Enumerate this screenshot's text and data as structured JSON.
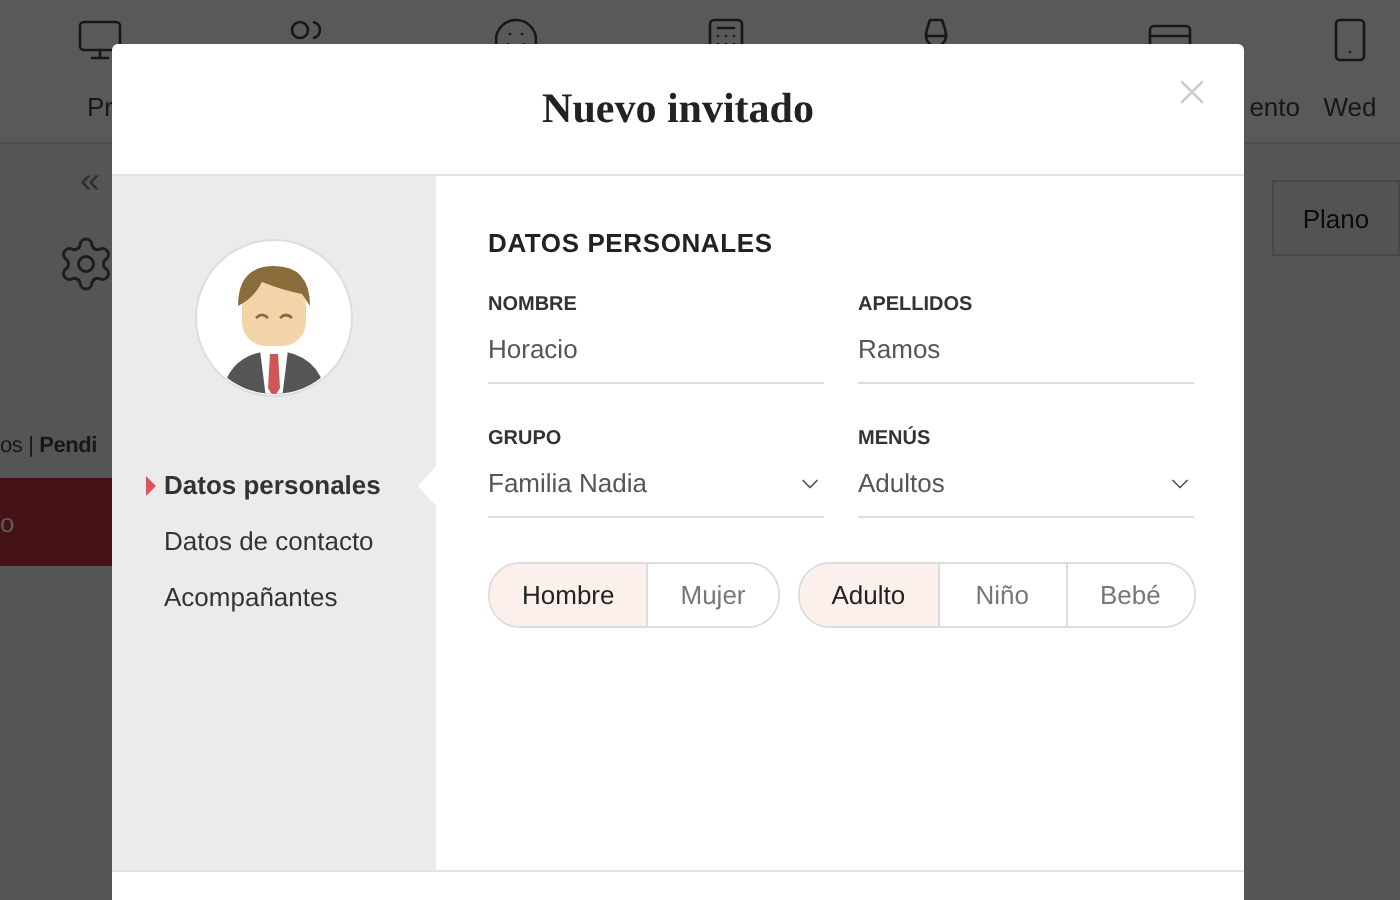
{
  "background": {
    "nav_items": [
      {
        "kind": "monitor",
        "label": "Pr"
      },
      {
        "kind": "users"
      },
      {
        "kind": "smile"
      },
      {
        "kind": "calculator"
      },
      {
        "kind": "wine"
      },
      {
        "kind": "card",
        "label": "ento"
      },
      {
        "kind": "phone",
        "label": "Wed"
      }
    ],
    "back_symbol": "«",
    "breadcrumb": "os | **Pendi**",
    "red_tab": "o",
    "plan_button": "Plano"
  },
  "modal": {
    "title": "Nuevo invitado",
    "sidebar": {
      "items": [
        {
          "label": "Datos personales",
          "selected": true
        },
        {
          "label": "Datos de contacto",
          "selected": false
        },
        {
          "label": "Acompañantes",
          "selected": false
        }
      ]
    },
    "section_title": "DATOS PERSONALES",
    "fields": [
      {
        "kind": "text",
        "label": "NOMBRE",
        "value": "Horacio"
      },
      {
        "kind": "text",
        "label": "APELLIDOS",
        "value": "Ramos"
      },
      {
        "kind": "select",
        "label": "GRUPO",
        "value": "Familia Nadia"
      },
      {
        "kind": "select",
        "label": "MENÚS",
        "value": "Adultos"
      }
    ],
    "toggle_groups": [
      [
        {
          "label": "Hombre",
          "selected": true
        },
        {
          "label": "Mujer",
          "selected": false
        }
      ],
      [
        {
          "label": "Adulto",
          "selected": true
        },
        {
          "label": "Niño",
          "selected": false
        },
        {
          "label": "Bebé",
          "selected": false
        }
      ]
    ]
  }
}
